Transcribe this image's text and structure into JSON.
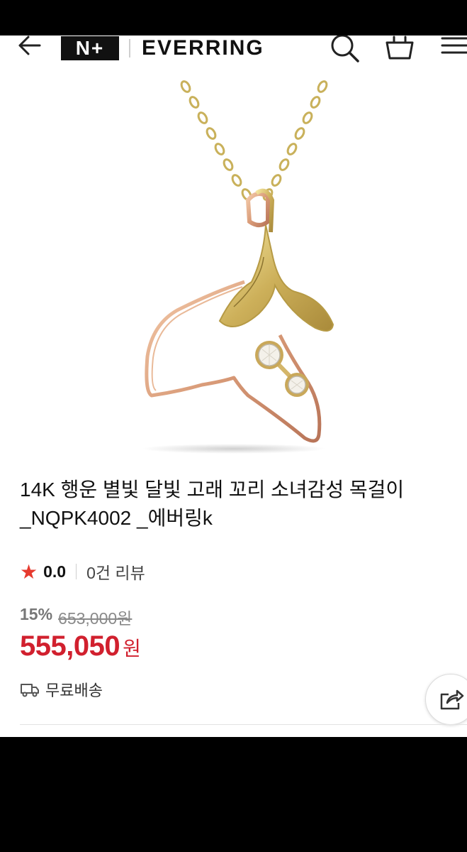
{
  "header": {
    "logo_badge": "N+",
    "brand": "EVERRING"
  },
  "product": {
    "title_line1": "14K 행운 별빛 달빛 고래 꼬리 소녀감성 목걸이",
    "title_line2": "_NQPK4002 _에버링k",
    "rating": "0.0",
    "review_count": "0건 리뷰",
    "discount": "15%",
    "original_price": "653,000원",
    "price": "555,050",
    "currency": "원",
    "shipping": "무료배송"
  },
  "icons": {
    "back": "arrow-left-icon",
    "search": "search-icon",
    "cart": "basket-icon",
    "menu": "hamburger-icon",
    "star": "star-icon",
    "shipping": "truck-icon",
    "share": "share-icon"
  },
  "colors": {
    "price": "#d1202e",
    "star": "#e63a2e"
  }
}
